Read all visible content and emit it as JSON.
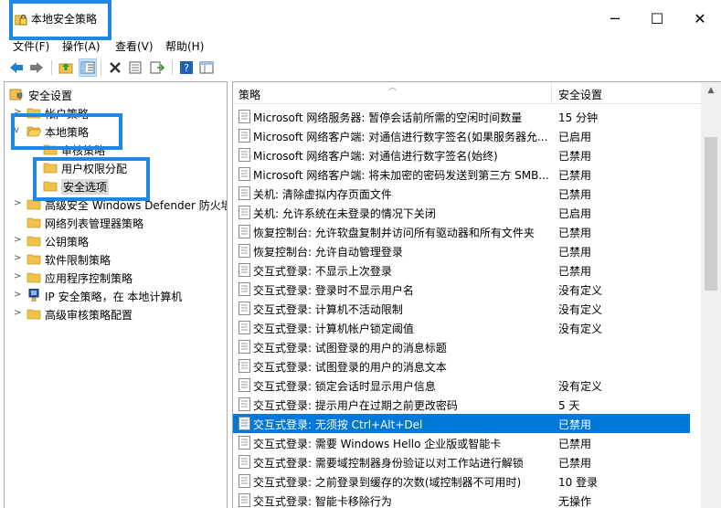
{
  "window": {
    "title": "本地安全策略"
  },
  "menu": [
    "文件(F)",
    "操作(A)",
    "查看(V)",
    "帮助(H)"
  ],
  "tree": [
    {
      "label": "安全设置",
      "icon": "shield-folder-icon"
    },
    {
      "label": "帐户策略",
      "icon": "folder-icon"
    },
    {
      "label": "本地策略",
      "icon": "folder-icon"
    },
    {
      "label": "审核策略",
      "icon": "folder-icon"
    },
    {
      "label": "用户权限分配",
      "icon": "folder-icon"
    },
    {
      "label": "安全选项",
      "icon": "folder-icon"
    },
    {
      "label": "高级安全 Windows Defender 防火墙",
      "icon": "folder-icon"
    },
    {
      "label": "网络列表管理器策略",
      "icon": "folder-icon"
    },
    {
      "label": "公钥策略",
      "icon": "folder-icon"
    },
    {
      "label": "软件限制策略",
      "icon": "folder-icon"
    },
    {
      "label": "应用程序控制策略",
      "icon": "folder-icon"
    },
    {
      "label": "IP 安全策略，在 本地计算机",
      "icon": "ip-security-icon"
    },
    {
      "label": "高级审核策略配置",
      "icon": "folder-icon"
    }
  ],
  "columns": {
    "policy": "策略",
    "setting": "安全设置"
  },
  "rows": [
    {
      "name": "Microsoft 网络服务器: 暂停会话前所需的空闲时间数量",
      "value": "15 分钟"
    },
    {
      "name": "Microsoft 网络客户端: 对通信进行数字签名(如果服务器允...",
      "value": "已启用"
    },
    {
      "name": "Microsoft 网络客户端: 对通信进行数字签名(始终)",
      "value": "已禁用"
    },
    {
      "name": "Microsoft 网络客户端: 将未加密的密码发送到第三方 SMB...",
      "value": "已禁用"
    },
    {
      "name": "关机: 清除虚拟内存页面文件",
      "value": "已禁用"
    },
    {
      "name": "关机: 允许系统在未登录的情况下关闭",
      "value": "已启用"
    },
    {
      "name": "恢复控制台: 允许软盘复制并访问所有驱动器和所有文件夹",
      "value": "已禁用"
    },
    {
      "name": "恢复控制台: 允许自动管理登录",
      "value": "已禁用"
    },
    {
      "name": "交互式登录: 不显示上次登录",
      "value": "已禁用"
    },
    {
      "name": "交互式登录: 登录时不显示用户名",
      "value": "没有定义"
    },
    {
      "name": "交互式登录: 计算机不活动限制",
      "value": "没有定义"
    },
    {
      "name": "交互式登录: 计算机帐户锁定阈值",
      "value": "没有定义"
    },
    {
      "name": "交互式登录: 试图登录的用户的消息标题",
      "value": ""
    },
    {
      "name": "交互式登录: 试图登录的用户的消息文本",
      "value": ""
    },
    {
      "name": "交互式登录: 锁定会话时显示用户信息",
      "value": "没有定义"
    },
    {
      "name": "交互式登录: 提示用户在过期之前更改密码",
      "value": "5 天"
    },
    {
      "name": "交互式登录: 无须按 Ctrl+Alt+Del",
      "value": "已禁用"
    },
    {
      "name": "交互式登录: 需要 Windows Hello 企业版或智能卡",
      "value": "已禁用"
    },
    {
      "name": "交互式登录: 需要域控制器身份验证以对工作站进行解锁",
      "value": "已禁用"
    },
    {
      "name": "交互式登录: 之前登录到缓存的次数(域控制器不可用时)",
      "value": "10 登录"
    },
    {
      "name": "交互式登录: 智能卡移除行为",
      "value": "无操作"
    }
  ],
  "colors": {
    "accent": "#0078d7",
    "highlight_box": "#1e88e5"
  }
}
